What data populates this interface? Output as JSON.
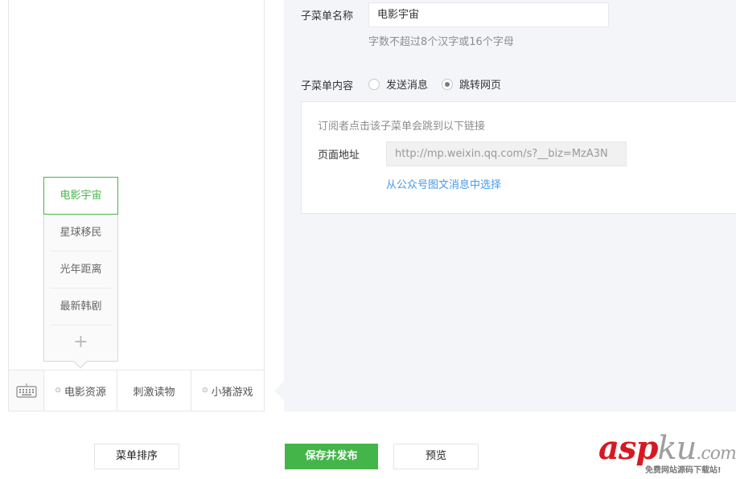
{
  "preview": {
    "submenu": {
      "items": [
        "电影宇宙",
        "星球移民",
        "光年距离",
        "最新韩剧"
      ],
      "active_index": 0,
      "add_symbol": "+"
    },
    "menubar": {
      "keyboard_icon": "keyboard-icon",
      "items": [
        {
          "label": "电影资源",
          "has_submenu": true
        },
        {
          "label": "刺激读物",
          "has_submenu": false
        },
        {
          "label": "小猪游戏",
          "has_submenu": true
        }
      ]
    }
  },
  "editor": {
    "name_label": "子菜单名称",
    "name_value": "电影宇宙",
    "name_hint": "字数不超过8个汉字或16个字母",
    "content_label": "子菜单内容",
    "radio_options": [
      {
        "label": "发送消息",
        "checked": false
      },
      {
        "label": "跳转网页",
        "checked": true
      }
    ],
    "panel": {
      "description": "订阅者点击该子菜单会跳到以下链接",
      "url_label": "页面地址",
      "url_value": "http://mp.weixin.qq.com/s?__biz=MzA3N",
      "link_text": "从公众号图文消息中选择"
    }
  },
  "buttons": {
    "sort": "菜单排序",
    "save_publish": "保存并发布",
    "preview": "预览"
  },
  "watermark": {
    "brand_main": "asp",
    "brand_tail": "ku",
    "brand_suffix": ".com",
    "tagline": "免费网站源码下载站!"
  },
  "colors": {
    "accent_green": "#44b549",
    "link_blue": "#459ae9",
    "editor_bg": "#f4f5f9",
    "watermark_red": "#d71921"
  }
}
